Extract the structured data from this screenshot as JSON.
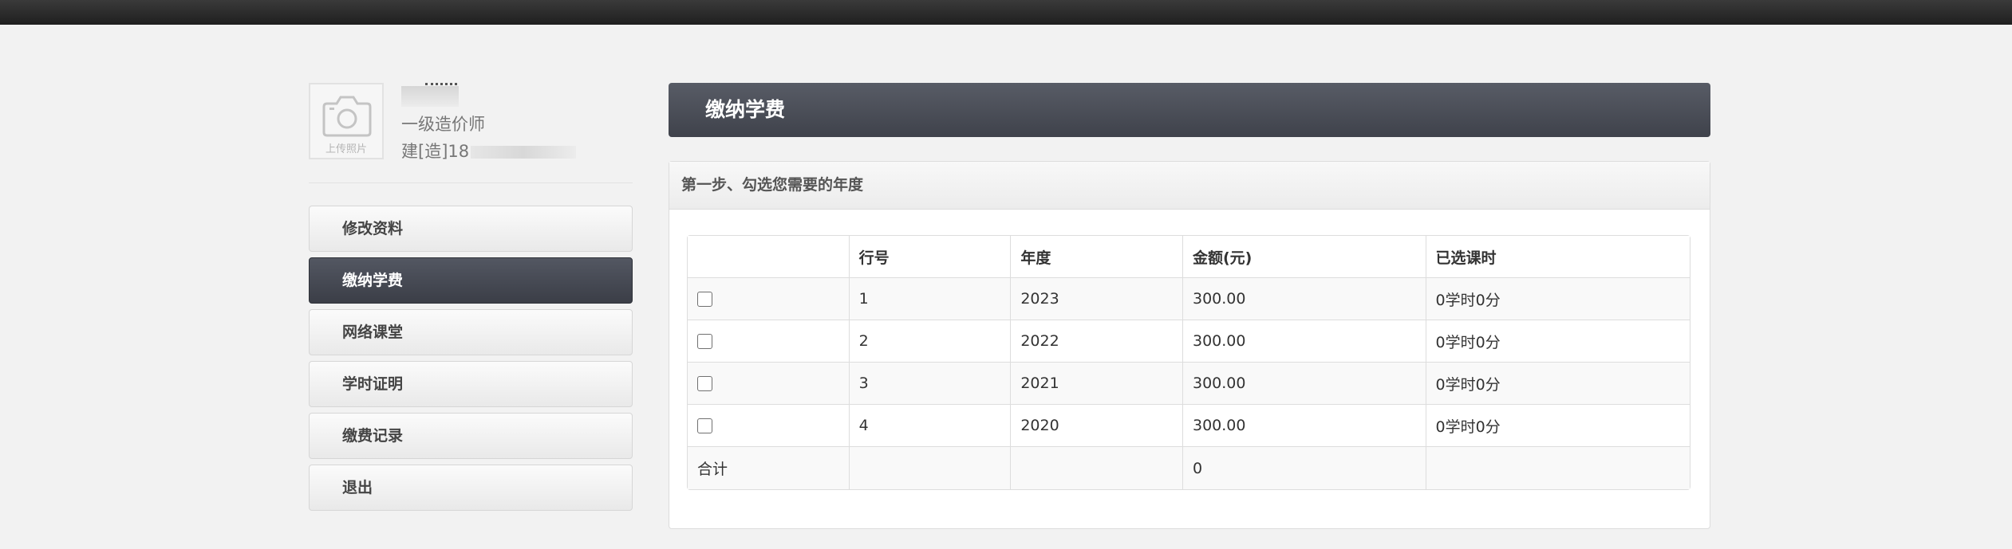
{
  "profile": {
    "upload_label": "上传照片",
    "title": "一级造价师",
    "cert_prefix": "建[造]18"
  },
  "menu": [
    {
      "label": "修改资料",
      "active": false
    },
    {
      "label": "缴纳学费",
      "active": true
    },
    {
      "label": "网络课堂",
      "active": false
    },
    {
      "label": "学时证明",
      "active": false
    },
    {
      "label": "缴费记录",
      "active": false
    },
    {
      "label": "退出",
      "active": false
    }
  ],
  "page_title": "缴纳学费",
  "step": {
    "heading": "第一步、勾选您需要的年度"
  },
  "table": {
    "headers": [
      "",
      "行号",
      "年度",
      "金额(元)",
      "已选课时"
    ],
    "rows": [
      {
        "no": "1",
        "year": "2023",
        "amount": "300.00",
        "hours": "0学时0分",
        "checked": false
      },
      {
        "no": "2",
        "year": "2022",
        "amount": "300.00",
        "hours": "0学时0分",
        "checked": false
      },
      {
        "no": "3",
        "year": "2021",
        "amount": "300.00",
        "hours": "0学时0分",
        "checked": false
      },
      {
        "no": "4",
        "year": "2020",
        "amount": "300.00",
        "hours": "0学时0分",
        "checked": false
      }
    ],
    "total": {
      "label": "合计",
      "amount": "0"
    }
  }
}
